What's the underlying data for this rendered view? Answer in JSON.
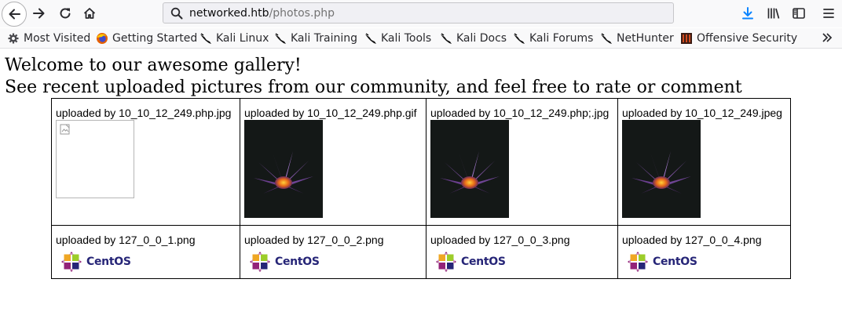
{
  "browser": {
    "url_host": "networked.htb",
    "url_path": "/photos.php",
    "bookmarks": [
      {
        "label": "Most Visited",
        "icon": "gear-icon"
      },
      {
        "label": "Getting Started",
        "icon": "firefox-icon"
      },
      {
        "label": "Kali Linux",
        "icon": "kali-dragon-icon"
      },
      {
        "label": "Kali Training",
        "icon": "kali-dragon-icon"
      },
      {
        "label": "Kali Tools",
        "icon": "kali-dragon-icon"
      },
      {
        "label": "Kali Docs",
        "icon": "kali-dragon-icon"
      },
      {
        "label": "Kali Forums",
        "icon": "kali-dragon-icon"
      },
      {
        "label": "NetHunter",
        "icon": "kali-dragon-icon"
      },
      {
        "label": "Offensive Security",
        "icon": "offsec-icon"
      }
    ]
  },
  "page": {
    "heading": "Welcome to our awesome gallery!",
    "subheading": "See recent uploaded pictures from our community, and feel free to rate or comment",
    "gallery": [
      {
        "caption": "uploaded by 10_10_12_249.php.jpg",
        "image": "broken-image"
      },
      {
        "caption": "uploaded by 10_10_12_249.php.gif",
        "image": "flower-photo"
      },
      {
        "caption": "uploaded by 10_10_12_249.php;.jpg",
        "image": "flower-photo"
      },
      {
        "caption": "uploaded by 10_10_12_249.jpeg",
        "image": "flower-photo"
      },
      {
        "caption": "uploaded by 127_0_0_1.png",
        "image": "centos-logo"
      },
      {
        "caption": "uploaded by 127_0_0_2.png",
        "image": "centos-logo"
      },
      {
        "caption": "uploaded by 127_0_0_3.png",
        "image": "centos-logo"
      },
      {
        "caption": "uploaded by 127_0_0_4.png",
        "image": "centos-logo"
      }
    ],
    "logo_text": "CentOS"
  },
  "colors": {
    "toolbar_bg": "#f9f9fa",
    "download_accent": "#0a84ff",
    "centos_purple": "#262577"
  }
}
